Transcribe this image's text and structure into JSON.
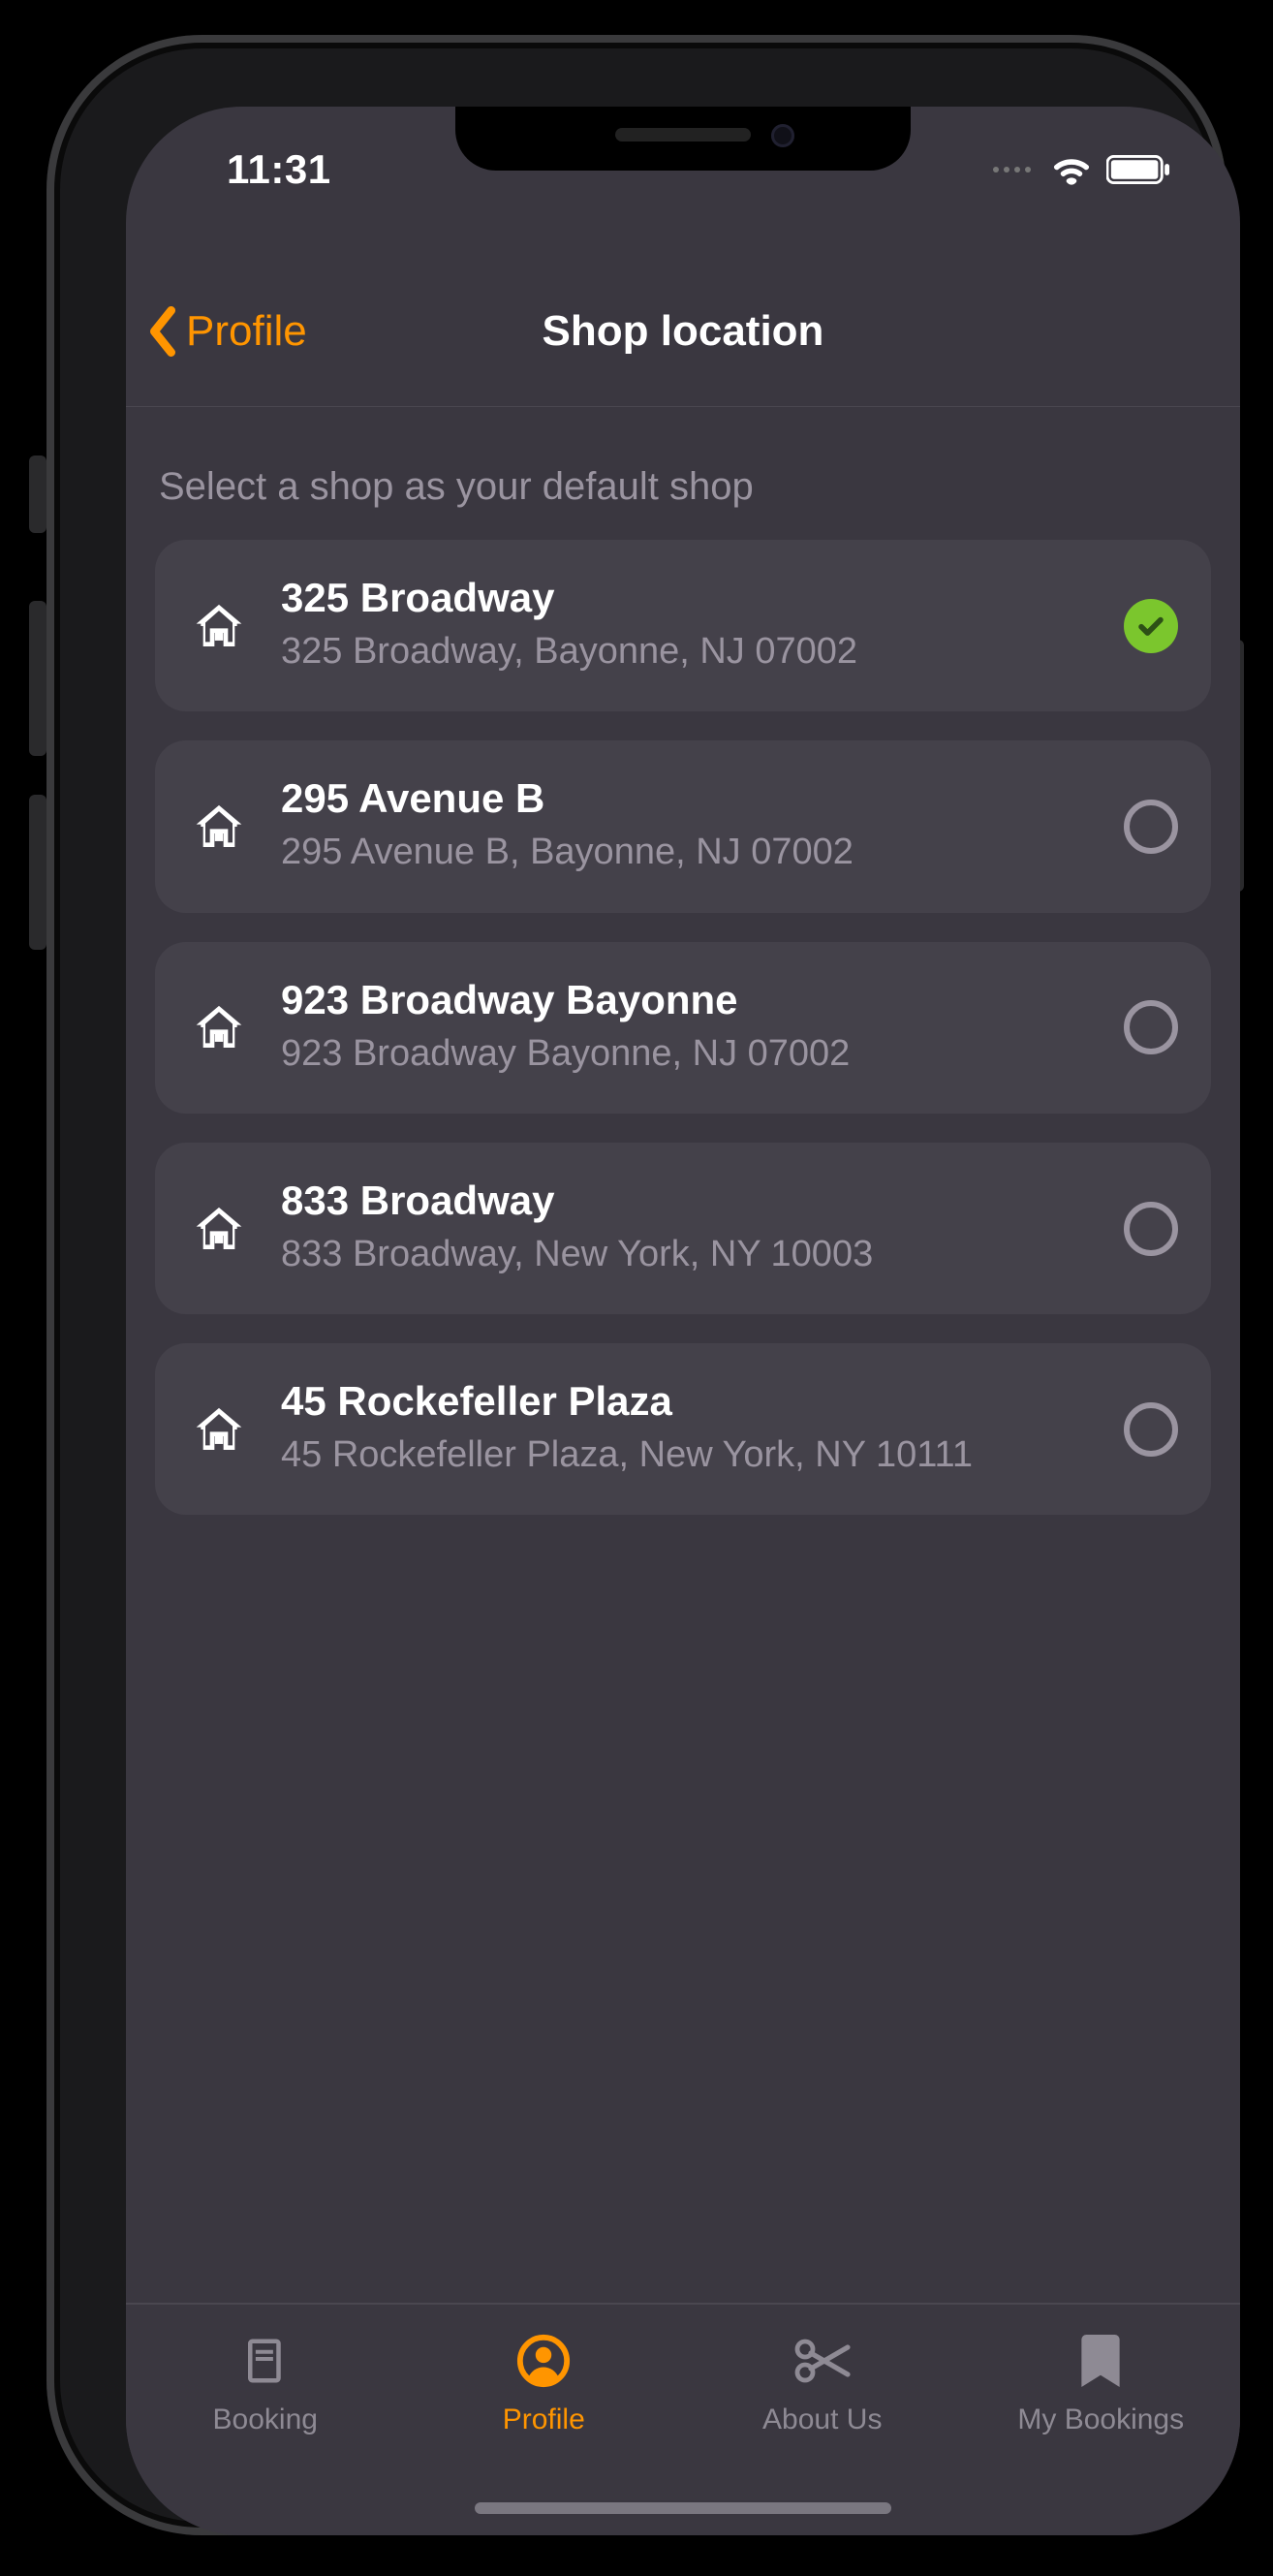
{
  "status": {
    "time": "11:31"
  },
  "nav": {
    "back_label": "Profile",
    "title": "Shop location"
  },
  "hint": "Select a shop as your default shop",
  "colors": {
    "accent": "#ff9500",
    "selected": "#7bc62d"
  },
  "shops": [
    {
      "name": "325 Broadway",
      "address": "325 Broadway, Bayonne, NJ 07002",
      "selected": true
    },
    {
      "name": "295 Avenue B",
      "address": "295 Avenue B, Bayonne, NJ 07002",
      "selected": false
    },
    {
      "name": "923 Broadway Bayonne",
      "address": "923 Broadway Bayonne, NJ 07002",
      "selected": false
    },
    {
      "name": "833 Broadway",
      "address": "833 Broadway, New York, NY 10003",
      "selected": false
    },
    {
      "name": "45 Rockefeller Plaza",
      "address": "45 Rockefeller Plaza, New York, NY 10111",
      "selected": false
    }
  ],
  "tabs": [
    {
      "label": "Booking",
      "icon": "book",
      "active": false
    },
    {
      "label": "Profile",
      "icon": "profile",
      "active": true
    },
    {
      "label": "About Us",
      "icon": "scissors",
      "active": false
    },
    {
      "label": "My Bookings",
      "icon": "bookmark",
      "active": false
    }
  ]
}
